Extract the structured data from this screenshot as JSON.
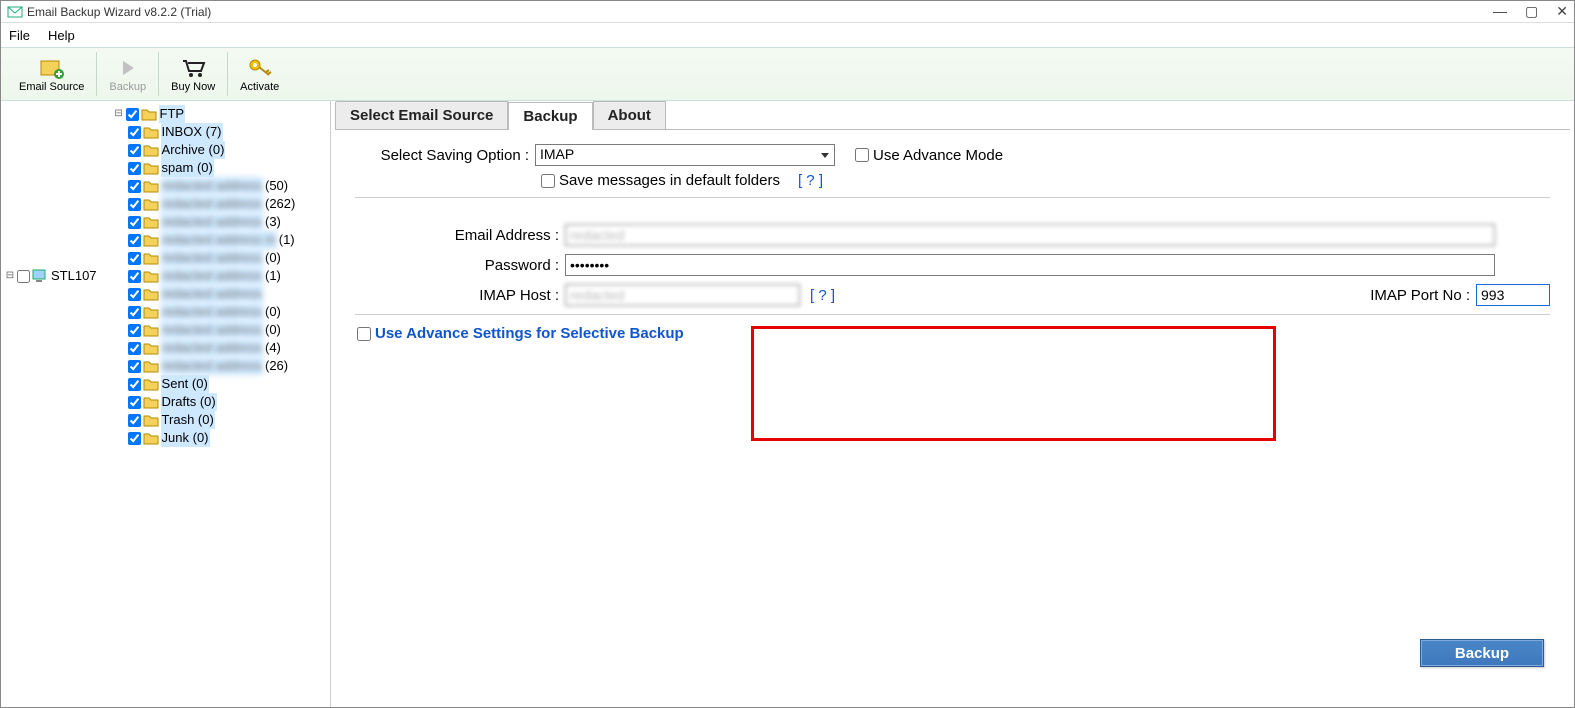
{
  "window": {
    "title": "Email Backup Wizard v8.2.2 (Trial)"
  },
  "menu": {
    "file": "File",
    "help": "Help"
  },
  "toolbar": {
    "email_source": "Email Source",
    "backup": "Backup",
    "buy_now": "Buy Now",
    "activate": "Activate"
  },
  "tree": {
    "root": "STL107",
    "account": "FTP",
    "items": [
      {
        "label": "INBOX (7)",
        "blur": false
      },
      {
        "label": "Archive (0)",
        "blur": false
      },
      {
        "label": "spam (0)",
        "blur": false
      },
      {
        "label": "redacted address",
        "count": "(50)",
        "blur": true
      },
      {
        "label": "redacted address",
        "count": "(262)",
        "blur": true
      },
      {
        "label": "redacted address",
        "count": "(3)",
        "blur": true
      },
      {
        "label": "redacted address in",
        "count": "(1)",
        "blur": true
      },
      {
        "label": "redacted address",
        "count": "(0)",
        "blur": true
      },
      {
        "label": "redacted address",
        "count": "(1)",
        "blur": true
      },
      {
        "label": "redacted address",
        "count": "",
        "blur": true
      },
      {
        "label": "redacted address",
        "count": "(0)",
        "blur": true
      },
      {
        "label": "redacted address",
        "count": "(0)",
        "blur": true
      },
      {
        "label": "redacted address",
        "count": "(4)",
        "blur": true
      },
      {
        "label": "redacted address",
        "count": "(26)",
        "blur": true
      },
      {
        "label": "Sent (0)",
        "blur": false
      },
      {
        "label": "Drafts (0)",
        "blur": false
      },
      {
        "label": "Trash (0)",
        "blur": false
      },
      {
        "label": "Junk (0)",
        "blur": false
      }
    ]
  },
  "tabs": {
    "t1": "Select Email Source",
    "t2": "Backup",
    "t3": "About"
  },
  "form": {
    "saving_option_label": "Select Saving Option :",
    "saving_option_value": "IMAP",
    "advance_mode": "Use Advance Mode",
    "save_default": "Save messages in default folders",
    "help": "[ ? ]",
    "email_label": "Email Address :",
    "email_value": "redacted",
    "password_label": "Password :",
    "password_value": "••••••••",
    "host_label": "IMAP Host :",
    "host_value": "redacted",
    "port_label": "IMAP Port No :",
    "port_value": "993",
    "adv_settings": "Use Advance Settings for Selective Backup"
  },
  "buttons": {
    "backup": "Backup"
  }
}
